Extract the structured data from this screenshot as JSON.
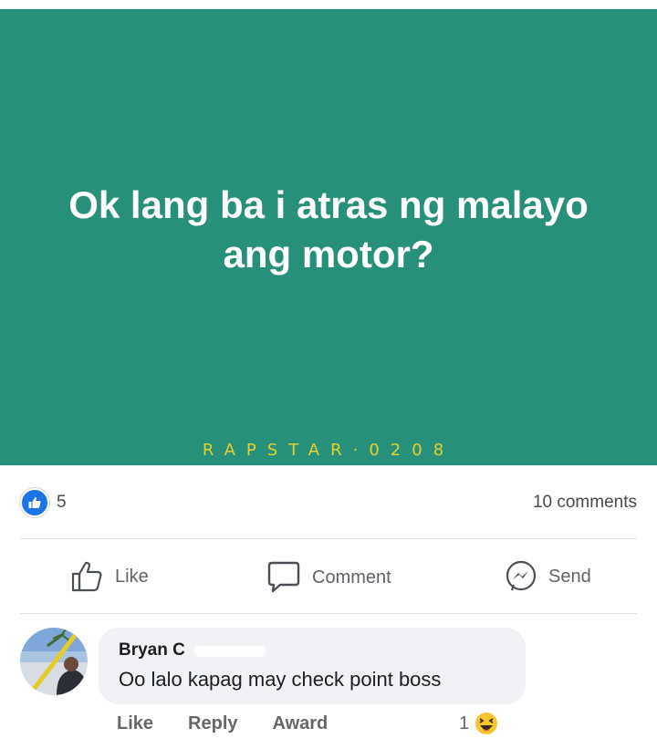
{
  "post": {
    "text": "Ok lang ba i atras ng malayo ang motor?",
    "watermark": "RAPSTAR·0208",
    "background_color": "#26907a"
  },
  "stats": {
    "reaction_icon": "like-icon",
    "reaction_count": "5",
    "comments": "10 comments"
  },
  "actions": {
    "like": "Like",
    "comment": "Comment",
    "send": "Send"
  },
  "comment": {
    "author": "Bryan C",
    "text": "Oo lalo kapag may check point boss",
    "like": "Like",
    "reply": "Reply",
    "award": "Award",
    "reaction_count": "1",
    "reaction_icon": "laughing-emoji-icon"
  }
}
